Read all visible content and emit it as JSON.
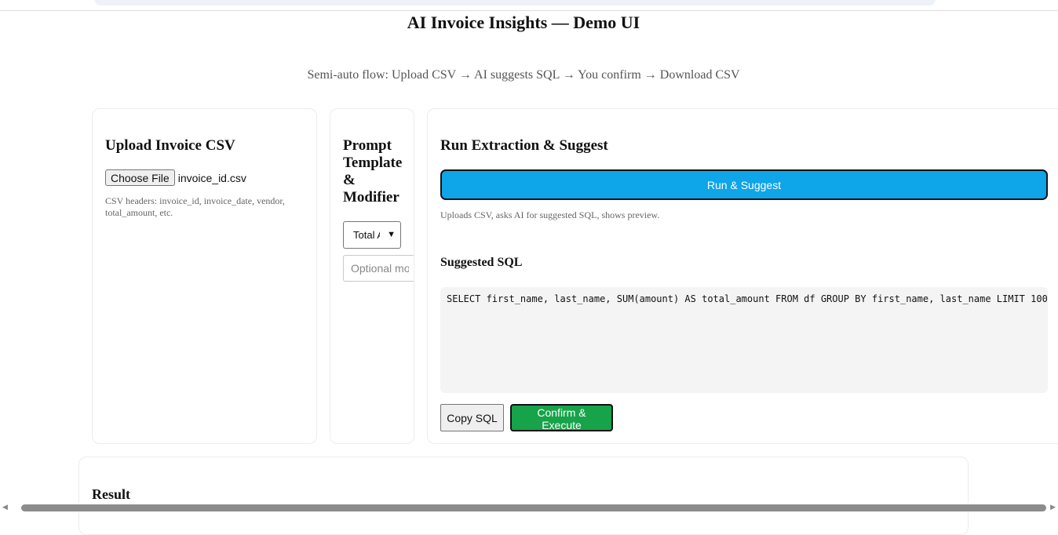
{
  "page": {
    "title": "AI Invoice Insights — Demo UI",
    "subtitle": "Semi-auto flow: Upload CSV → AI suggests SQL → You confirm → Download CSV"
  },
  "upload": {
    "heading": "Upload Invoice CSV",
    "choose_file_label": "Choose File",
    "file_name": "invoice_id.csv",
    "hint": "CSV headers: invoice_id, invoice_date, vendor, total_amount, etc."
  },
  "prompt": {
    "heading": "Prompt Template & Modifier",
    "template_select_value": "Total A",
    "modifier_placeholder": "Optional modifier"
  },
  "run": {
    "heading": "Run Extraction & Suggest",
    "run_button_label": "Run & Suggest",
    "hint": "Uploads CSV, asks AI for suggested SQL, shows preview.",
    "suggested_sql_label": "Suggested SQL",
    "suggested_sql": "SELECT first_name, last_name, SUM(amount) AS total_amount FROM df GROUP BY first_name, last_name LIMIT 100",
    "copy_button_label": "Copy SQL",
    "confirm_button_label": "Confirm & Execute"
  },
  "result": {
    "heading": "Result"
  },
  "icons": {
    "scroll_left": "scroll-left-arrow-icon",
    "scroll_right": "scroll-right-arrow-icon",
    "select_caret": "chevron-down-icon"
  },
  "colors": {
    "run_button": "#0ea5e9",
    "confirm_button": "#16a34a",
    "sql_box_bg": "#f4f4f4"
  }
}
